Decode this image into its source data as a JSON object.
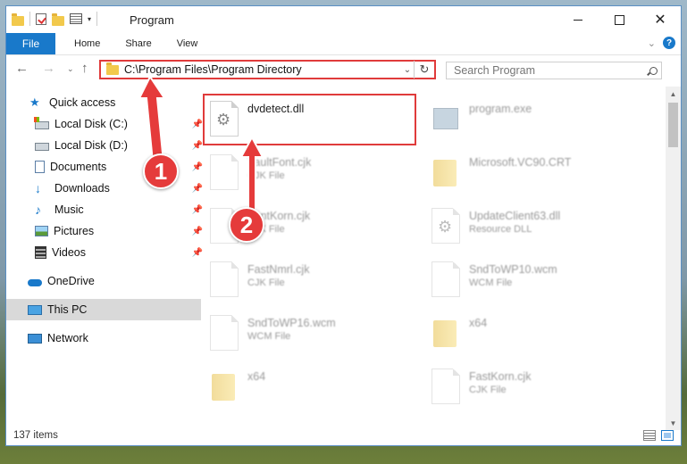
{
  "window": {
    "title": "Program"
  },
  "ribbon": {
    "file_tab": "File",
    "tabs": [
      "Home",
      "Share",
      "View"
    ]
  },
  "address": {
    "path": "C:\\Program Files\\Program Directory"
  },
  "search": {
    "placeholder": "Search Program"
  },
  "sidebar": {
    "items": [
      {
        "label": "Quick access",
        "icon": "star-icon"
      },
      {
        "label": "Local Disk (C:)",
        "icon": "drive-icon",
        "pinned": true
      },
      {
        "label": "Local Disk (D:)",
        "icon": "drive-icon",
        "pinned": true
      },
      {
        "label": "Documents",
        "icon": "document-icon",
        "pinned": true
      },
      {
        "label": "Downloads",
        "icon": "download-icon",
        "pinned": true
      },
      {
        "label": "Music",
        "icon": "music-icon",
        "pinned": true
      },
      {
        "label": "Pictures",
        "icon": "picture-icon",
        "pinned": true
      },
      {
        "label": "Videos",
        "icon": "video-icon",
        "pinned": true
      },
      {
        "label": "OneDrive",
        "icon": "cloud-icon"
      },
      {
        "label": "This PC",
        "icon": "computer-icon",
        "selected": true
      },
      {
        "label": "Network",
        "icon": "network-icon"
      }
    ]
  },
  "files": [
    {
      "name": "dvdetect.dll",
      "type": "",
      "icon": "dll-icon"
    },
    {
      "name": "program.exe",
      "type": "",
      "icon": "exe-icon"
    },
    {
      "name": "VaultFont.cjk",
      "type": "CJK File",
      "icon": "file-icon"
    },
    {
      "name": "Microsoft.VC90.CRT",
      "type": "",
      "icon": "folder-icon"
    },
    {
      "name": "FontKorn.cjk",
      "type": "CJK File",
      "icon": "file-icon"
    },
    {
      "name": "UpdateClient63.dll",
      "type": "Resource DLL",
      "icon": "dll-icon"
    },
    {
      "name": "FastNmrl.cjk",
      "type": "CJK File",
      "icon": "file-icon"
    },
    {
      "name": "SndToWP10.wcm",
      "type": "WCM File",
      "icon": "file-icon"
    },
    {
      "name": "SndToWP16.wcm",
      "type": "WCM File",
      "icon": "file-icon"
    },
    {
      "name": "x64",
      "type": "",
      "icon": "folder-icon"
    },
    {
      "name": "x64",
      "type": "",
      "icon": "folder-icon"
    },
    {
      "name": "FastKorn.cjk",
      "type": "CJK File",
      "icon": "file-icon"
    }
  ],
  "status": {
    "item_count": "137 items"
  },
  "annotations": {
    "step1": "1",
    "step2": "2",
    "color": "#e53b3b"
  }
}
